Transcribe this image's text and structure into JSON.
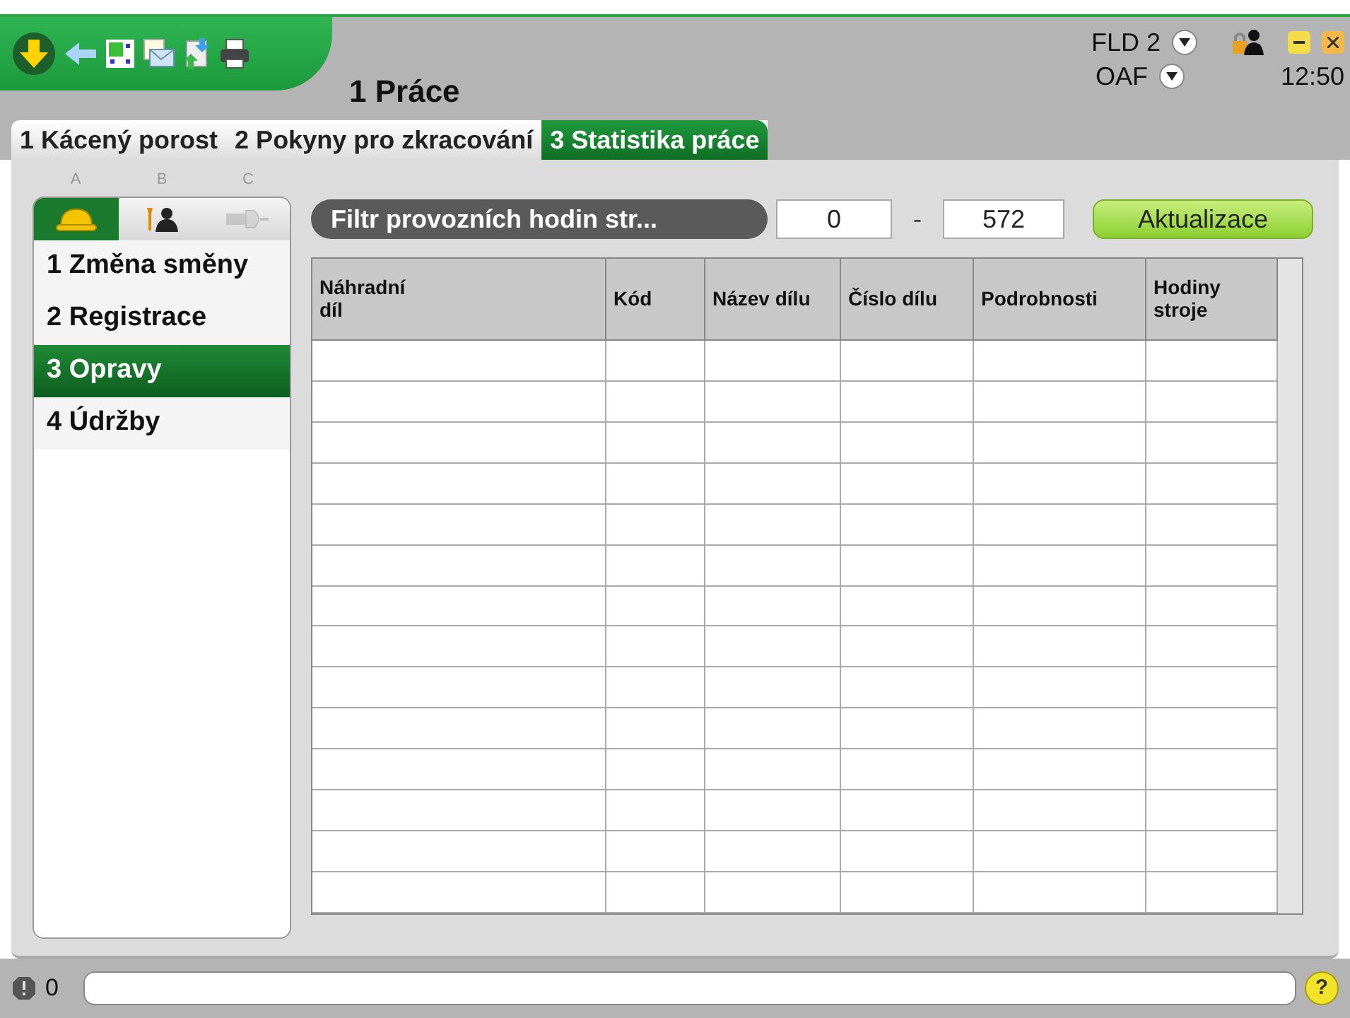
{
  "header": {
    "title": "1 Práce",
    "machine": "FLD 2",
    "operator": "OAF",
    "time": "12:50"
  },
  "tabs": [
    {
      "label": "1 Kácený porost",
      "selected": false
    },
    {
      "label": "2 Pokyny pro zkracování",
      "selected": false
    },
    {
      "label": "3 Statistika práce",
      "selected": true
    }
  ],
  "side_tabs": [
    {
      "letter": "A",
      "kind": "helmet",
      "selected": true,
      "disabled": false
    },
    {
      "letter": "B",
      "kind": "service",
      "selected": false,
      "disabled": false
    },
    {
      "letter": "C",
      "kind": "plug",
      "selected": false,
      "disabled": true
    }
  ],
  "side_items": [
    {
      "label": "1 Změna směny",
      "selected": false
    },
    {
      "label": "2 Registrace",
      "selected": false
    },
    {
      "label": "3 Opravy",
      "selected": true
    },
    {
      "label": "4 Údržby",
      "selected": false
    }
  ],
  "filter": {
    "label": "Filtr provozních hodin str...",
    "from": "0",
    "separator": "-",
    "to": "572",
    "button": "Aktualizace"
  },
  "table": {
    "columns": [
      "Náhradní díl",
      "Kód",
      "Název dílu",
      "Číslo dílu",
      "Podrobnosti",
      "Hodiny stroje"
    ]
  },
  "status_bar": {
    "alert_count": "0",
    "help": "?"
  }
}
